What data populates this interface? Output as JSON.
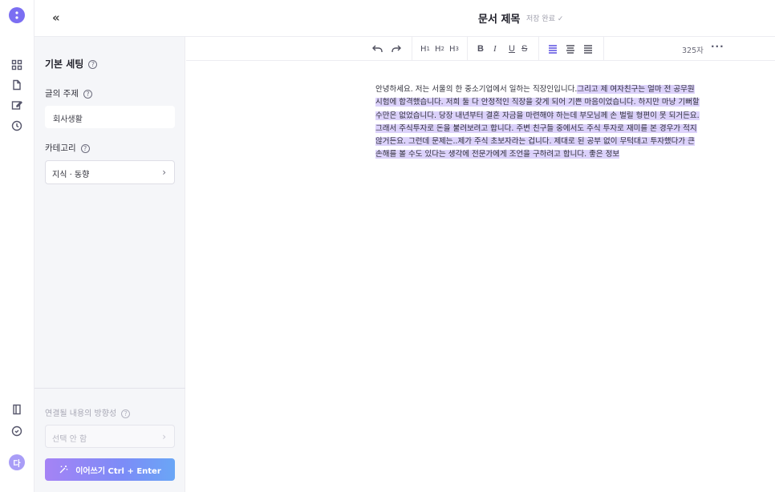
{
  "header": {
    "collapse_label": "«",
    "doc_title": "문서 제목",
    "save_status": "저장 완료 ✓"
  },
  "rail": {
    "avatar_initial": "다",
    "icons": [
      "logo-icon",
      "grid-icon",
      "document-icon",
      "edit-icon",
      "history-icon",
      "panel-icon",
      "feedback-icon"
    ]
  },
  "panel": {
    "title": "기본 세팅",
    "topic_label": "글의 주제",
    "topic_value": "회사생활",
    "category_label": "카테고리",
    "category_value": "지식 · 동향",
    "direction_label": "연결될 내용의 방향성",
    "direction_value": "선택 안 함",
    "continue_button": "이어쓰기 Ctrl + Enter"
  },
  "toolbar": {
    "h1": "H",
    "h1_sub": "1",
    "h2": "H",
    "h2_sub": "2",
    "h3": "H",
    "h3_sub": "3",
    "bold": "B",
    "italic": "I",
    "underline": "U",
    "strike": "S",
    "char_count": "325자",
    "more": "···"
  },
  "editor": {
    "plain_text": "안녕하세요. 저는 서울의 한 중소기업에서 일하는 직장인입니다.",
    "highlighted_text": "그리고 제 여자친구는 얼마 전 공무원 시험에 합격했습니다. 저희 둘 다 안정적인 직장을 갖게 되어 기쁜 마음이었습니다. 하지만 마냥 기뻐할 수만은 없었습니다. 당장 내년부터 결혼 자금을 마련해야 하는데 부모님께 손 벌릴 형편이 못 되거든요. 그래서 주식투자로 돈을 불려보려고 합니다. 주변 친구들 중에서도 주식 투자로 재미를 본 경우가 적지 않거든요. 그런데 문제는..제가 주식 초보자라는 겁니다. 제대로 된 공부 없이 무턱대고 투자했다가 큰 손해를 볼 수도 있다는 생각에 전문가에게 조언을 구하려고 합니다. 좋은 정보"
  },
  "colors": {
    "accent": "#7b6ef2",
    "highlight": "#dcd2fb",
    "panel_bg": "#f5f6f9"
  }
}
